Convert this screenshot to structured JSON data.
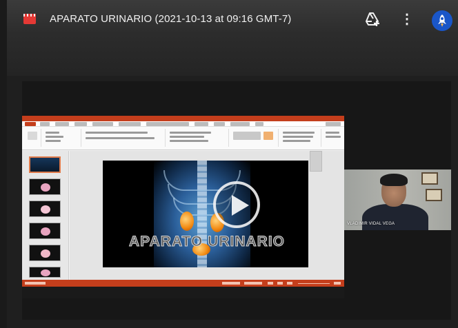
{
  "meeting": {
    "title": "APARATO URINARIO (2021-10-13 at 09:16 GMT-7)",
    "file_icon": "video-file-icon",
    "actions": [
      {
        "name": "add-to-drive-icon"
      },
      {
        "name": "more-vert-icon",
        "glyph": "⋮"
      }
    ],
    "avatar_icon": "rocket-icon",
    "accent": "#1a56c8"
  },
  "presentation": {
    "app_color": "#c43e1c",
    "slide_title": "APARATO URINARIO",
    "thumbnail_count": 6
  },
  "participant": {
    "name": "VLADIMIR VIDAL VEGA"
  }
}
